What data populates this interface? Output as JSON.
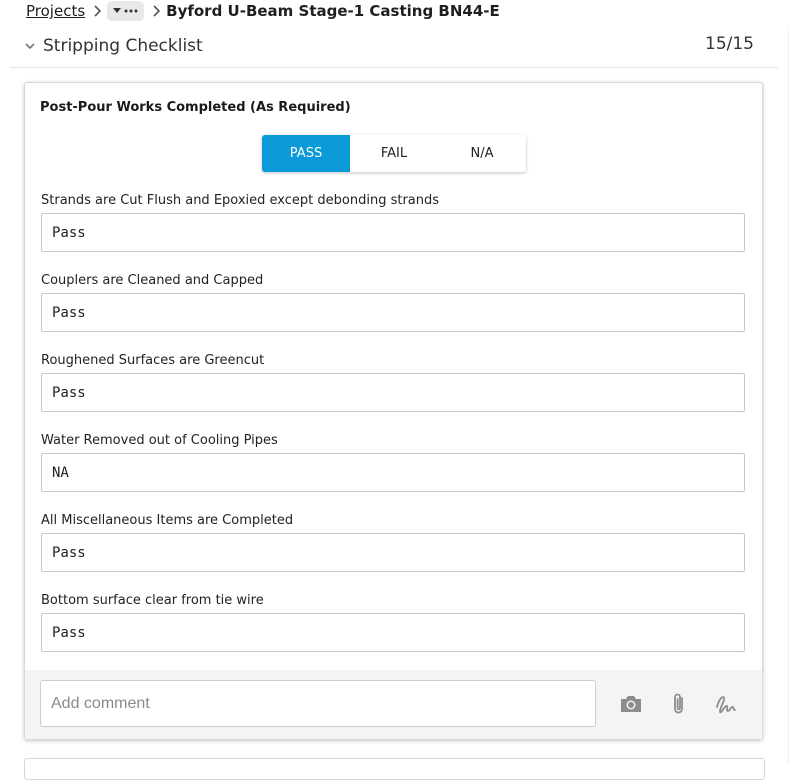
{
  "breadcrumb": {
    "root": "Projects",
    "current": "Byford U-Beam Stage-1 Casting BN44-E"
  },
  "section": {
    "title": "Stripping Checklist",
    "count": "15/15"
  },
  "card": {
    "title": "Post-Pour Works Completed (As Required)",
    "segments": [
      "PASS",
      "FAIL",
      "N/A"
    ],
    "selected": "PASS",
    "fields": [
      {
        "label": "Strands are Cut Flush and Epoxied except debonding strands",
        "value": "Pass"
      },
      {
        "label": "Couplers are Cleaned and Capped",
        "value": "Pass"
      },
      {
        "label": "Roughened Surfaces are Greencut",
        "value": "Pass"
      },
      {
        "label": "Water Removed out of Cooling Pipes",
        "value": "NA"
      },
      {
        "label": "All Miscellaneous Items are Completed",
        "value": "Pass"
      },
      {
        "label": "Bottom surface clear from tie wire",
        "value": "Pass"
      }
    ]
  },
  "comment": {
    "placeholder": "Add comment",
    "icons": [
      "camera-icon",
      "paperclip-icon",
      "signature-icon"
    ]
  },
  "colors": {
    "accent": "#0a9ad7"
  }
}
